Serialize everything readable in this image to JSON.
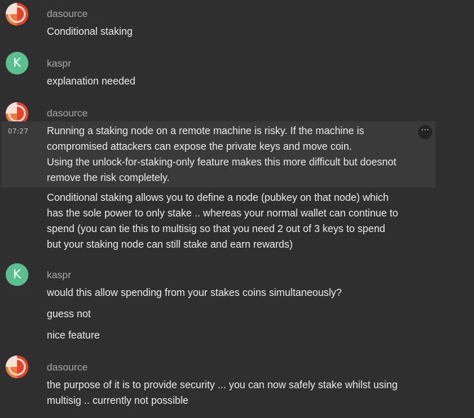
{
  "messages": [
    {
      "user": "dasource",
      "lines": [
        "Conditional staking"
      ]
    },
    {
      "user": "kaspr",
      "avatar_letter": "K",
      "lines": [
        "explanation needed"
      ]
    },
    {
      "user": "dasource",
      "timestamp": "07:27",
      "hover_lines": [
        "Running a staking node on a remote machine is risky. If the machine is",
        "compromised attackers can expose the private keys and move coin.",
        "Using the unlock-for-staking-only feature makes this more difficult but doesnot",
        "remove the risk completely."
      ],
      "lines": [
        "Conditional staking allows you to define a node (pubkey on that node) which",
        "has the sole power to only stake .. whereas your normal wallet can continue to",
        "spend (you can tie this to multisig so that you need 2 out of 3 keys to spend",
        "but your staking node can still stake and earn rewards)"
      ]
    },
    {
      "user": "kaspr",
      "avatar_letter": "K",
      "lines": [
        "would this allow spending from your stakes coins simultaneously?",
        "guess not",
        "nice feature"
      ]
    },
    {
      "user": "dasource",
      "lines": [
        "the purpose of it is to provide security ... you can now safely stake whilst using",
        "multisig .. currently not possible"
      ]
    }
  ],
  "more_button_label": "···",
  "icons": {
    "dasource_avatar": "quartered-circle-avatar-icon",
    "more": "more-options-icon"
  },
  "colors": {
    "background": "#2f2f2f",
    "hover_background": "#3a3a3a",
    "kaspr_avatar": "#5bbf8f",
    "dasource_avatar_red": "#e0452e",
    "dasource_avatar_orange": "#f07a3c",
    "dasource_avatar_light": "#f3e3d6"
  }
}
